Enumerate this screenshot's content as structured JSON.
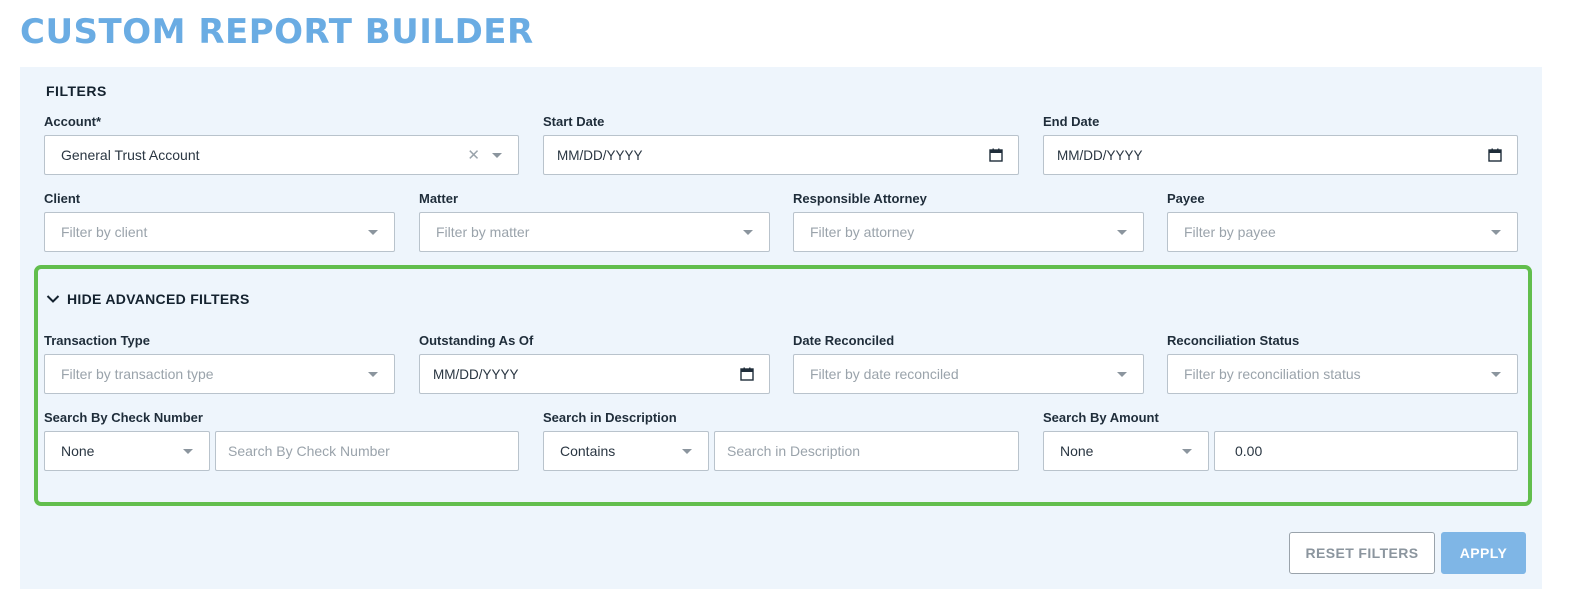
{
  "page": {
    "title": "CUSTOM REPORT BUILDER"
  },
  "filters": {
    "section_title": "FILTERS",
    "account": {
      "label": "Account*",
      "value": "General Trust Account"
    },
    "start_date": {
      "label": "Start Date",
      "value": "MM/DD/YYYY"
    },
    "end_date": {
      "label": "End Date",
      "value": "MM/DD/YYYY"
    },
    "client": {
      "label": "Client",
      "placeholder": "Filter by client"
    },
    "matter": {
      "label": "Matter",
      "placeholder": "Filter by matter"
    },
    "attorney": {
      "label": "Responsible Attorney",
      "placeholder": "Filter by attorney"
    },
    "payee": {
      "label": "Payee",
      "placeholder": "Filter by payee"
    }
  },
  "advanced": {
    "toggle_label": "HIDE ADVANCED FILTERS",
    "transaction_type": {
      "label": "Transaction Type",
      "placeholder": "Filter by transaction type"
    },
    "outstanding_as_of": {
      "label": "Outstanding As Of",
      "value": "MM/DD/YYYY"
    },
    "date_reconciled": {
      "label": "Date Reconciled",
      "placeholder": "Filter by date reconciled"
    },
    "reconciliation_status": {
      "label": "Reconciliation Status",
      "placeholder": "Filter by reconciliation status"
    },
    "check_number": {
      "label": "Search By Check Number",
      "operator": "None",
      "placeholder": "Search By Check Number"
    },
    "description": {
      "label": "Search in Description",
      "operator": "Contains",
      "placeholder": "Search in Description"
    },
    "amount": {
      "label": "Search By Amount",
      "operator": "None",
      "value": "0.00"
    }
  },
  "actions": {
    "reset_label": "RESET FILTERS",
    "apply_label": "APPLY"
  },
  "colors": {
    "title": "#6aace3",
    "panel_bg": "#eef5fc",
    "highlight_border": "#62be4d",
    "apply_bg": "#7fb6e6"
  },
  "icons": {
    "date": "calendar-icon",
    "select": "caret-down-icon",
    "clear": "close-icon",
    "toggle": "chevron-down-icon"
  }
}
